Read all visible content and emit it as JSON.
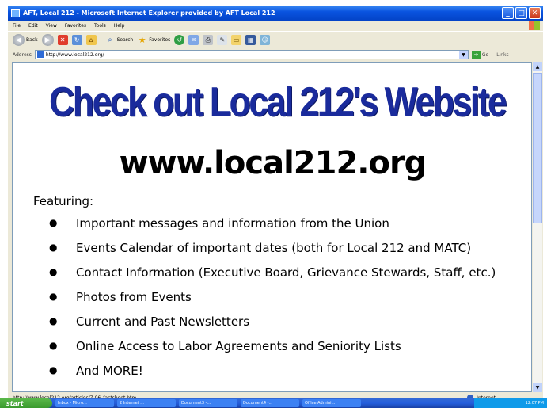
{
  "window": {
    "title": "AFT, Local 212 - Microsoft Internet Explorer provided by AFT Local 212",
    "min_label": "_",
    "max_label": "□",
    "close_label": "✕"
  },
  "menu": [
    "File",
    "Edit",
    "View",
    "Favorites",
    "Tools",
    "Help"
  ],
  "toolbar": {
    "back_label": "Back",
    "search_label": "Search",
    "favorites_label": "Favorites"
  },
  "address": {
    "label": "Address",
    "url": "http://www.local212.org/",
    "go_label": "Go",
    "links_label": "Links"
  },
  "page": {
    "headline": "Check out Local 212's Website",
    "site_url": "www.local212.org",
    "featuring": "Featuring:",
    "features": [
      "Important messages and information from the Union",
      "Events Calendar of important dates (both for Local 212 and MATC)",
      "Contact Information (Executive Board, Grievance Stewards, Staff, etc.)",
      "Photos from Events",
      "Current and Past Newsletters",
      "Online Access to Labor Agreements and Seniority Lists",
      "And MORE!"
    ]
  },
  "status": {
    "text": "http://www.local212.org/articles/7-06_factsheet.htm",
    "zone": "Internet"
  },
  "taskbar": {
    "start_label": "start",
    "tasks": [
      "Inbox - Micro...",
      "2 Internet ...",
      "Document3 -...",
      "Document4 -...",
      "Office Admini..."
    ],
    "clock": "12:07 PM"
  },
  "colors": {
    "headline": "#1a2b9c",
    "titlebar": "#0a54e0",
    "taskbar": "#245edc",
    "start": "#3a9a2e"
  }
}
